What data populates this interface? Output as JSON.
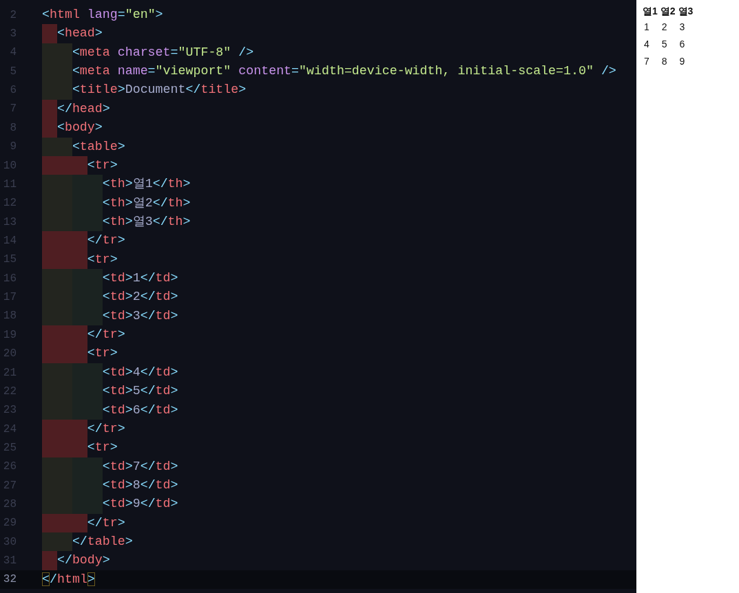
{
  "editor": {
    "lines": [
      {
        "number": "2",
        "current": false,
        "tokens": [
          {
            "kind": "bracket",
            "text": "<"
          },
          {
            "kind": "tag",
            "text": "html"
          },
          {
            "kind": "attr",
            "text": " lang"
          },
          {
            "kind": "punct",
            "text": "="
          },
          {
            "kind": "string",
            "text": "\"en\""
          },
          {
            "kind": "bracket",
            "text": ">"
          }
        ]
      },
      {
        "number": "3",
        "guides": [
          {
            "kind": "error-half"
          }
        ],
        "current": false,
        "tokens": [
          {
            "kind": "bracket",
            "text": "<"
          },
          {
            "kind": "tag",
            "text": "head"
          },
          {
            "kind": "bracket",
            "text": ">"
          }
        ]
      },
      {
        "number": "4",
        "guides": [
          {
            "kind": "ok"
          }
        ],
        "current": false,
        "tokens": [
          {
            "kind": "bracket",
            "text": "<"
          },
          {
            "kind": "tag",
            "text": "meta"
          },
          {
            "kind": "attr",
            "text": " charset"
          },
          {
            "kind": "punct",
            "text": "="
          },
          {
            "kind": "string",
            "text": "\"UTF-8\""
          },
          {
            "kind": "bracket",
            "text": " />"
          }
        ]
      },
      {
        "number": "5",
        "guides": [
          {
            "kind": "ok"
          }
        ],
        "current": false,
        "tokens": [
          {
            "kind": "bracket",
            "text": "<"
          },
          {
            "kind": "tag",
            "text": "meta"
          },
          {
            "kind": "attr",
            "text": " name"
          },
          {
            "kind": "punct",
            "text": "="
          },
          {
            "kind": "string",
            "text": "\"viewport\""
          },
          {
            "kind": "attr",
            "text": " content"
          },
          {
            "kind": "punct",
            "text": "="
          },
          {
            "kind": "string",
            "text": "\"width=device-width, initial-scale=1.0\""
          },
          {
            "kind": "bracket",
            "text": " />"
          }
        ]
      },
      {
        "number": "6",
        "guides": [
          {
            "kind": "ok"
          }
        ],
        "current": false,
        "tokens": [
          {
            "kind": "bracket",
            "text": "<"
          },
          {
            "kind": "tag",
            "text": "title"
          },
          {
            "kind": "bracket",
            "text": ">"
          },
          {
            "kind": "text",
            "text": "Document"
          },
          {
            "kind": "bracket",
            "text": "</"
          },
          {
            "kind": "tag",
            "text": "title"
          },
          {
            "kind": "bracket",
            "text": ">"
          }
        ]
      },
      {
        "number": "7",
        "guides": [
          {
            "kind": "error-half"
          }
        ],
        "current": false,
        "tokens": [
          {
            "kind": "bracket",
            "text": "</"
          },
          {
            "kind": "tag",
            "text": "head"
          },
          {
            "kind": "bracket",
            "text": ">"
          }
        ]
      },
      {
        "number": "8",
        "guides": [
          {
            "kind": "error-half"
          }
        ],
        "current": false,
        "tokens": [
          {
            "kind": "bracket",
            "text": "<"
          },
          {
            "kind": "tag",
            "text": "body"
          },
          {
            "kind": "bracket",
            "text": ">"
          }
        ]
      },
      {
        "number": "9",
        "guides": [
          {
            "kind": "ok"
          }
        ],
        "current": false,
        "tokens": [
          {
            "kind": "bracket",
            "text": "<"
          },
          {
            "kind": "tag",
            "text": "table"
          },
          {
            "kind": "bracket",
            "text": ">"
          }
        ]
      },
      {
        "number": "10",
        "guides": [
          {
            "kind": "error"
          },
          {
            "kind": "error-half"
          }
        ],
        "current": false,
        "tokens": [
          {
            "kind": "bracket",
            "text": "<"
          },
          {
            "kind": "tag",
            "text": "tr"
          },
          {
            "kind": "bracket",
            "text": ">"
          }
        ]
      },
      {
        "number": "11",
        "guides": [
          {
            "kind": "ok"
          },
          {
            "kind": "ok"
          }
        ],
        "current": false,
        "tokens": [
          {
            "kind": "bracket",
            "text": "<"
          },
          {
            "kind": "tag",
            "text": "th"
          },
          {
            "kind": "bracket",
            "text": ">"
          },
          {
            "kind": "text",
            "text": "열1"
          },
          {
            "kind": "bracket",
            "text": "</"
          },
          {
            "kind": "tag",
            "text": "th"
          },
          {
            "kind": "bracket",
            "text": ">"
          }
        ]
      },
      {
        "number": "12",
        "guides": [
          {
            "kind": "ok"
          },
          {
            "kind": "ok"
          }
        ],
        "current": false,
        "tokens": [
          {
            "kind": "bracket",
            "text": "<"
          },
          {
            "kind": "tag",
            "text": "th"
          },
          {
            "kind": "bracket",
            "text": ">"
          },
          {
            "kind": "text",
            "text": "열2"
          },
          {
            "kind": "bracket",
            "text": "</"
          },
          {
            "kind": "tag",
            "text": "th"
          },
          {
            "kind": "bracket",
            "text": ">"
          }
        ]
      },
      {
        "number": "13",
        "guides": [
          {
            "kind": "ok"
          },
          {
            "kind": "ok"
          }
        ],
        "current": false,
        "tokens": [
          {
            "kind": "bracket",
            "text": "<"
          },
          {
            "kind": "tag",
            "text": "th"
          },
          {
            "kind": "bracket",
            "text": ">"
          },
          {
            "kind": "text",
            "text": "열3"
          },
          {
            "kind": "bracket",
            "text": "</"
          },
          {
            "kind": "tag",
            "text": "th"
          },
          {
            "kind": "bracket",
            "text": ">"
          }
        ]
      },
      {
        "number": "14",
        "guides": [
          {
            "kind": "error"
          },
          {
            "kind": "error-half"
          }
        ],
        "current": false,
        "tokens": [
          {
            "kind": "bracket",
            "text": "</"
          },
          {
            "kind": "tag",
            "text": "tr"
          },
          {
            "kind": "bracket",
            "text": ">"
          }
        ]
      },
      {
        "number": "15",
        "guides": [
          {
            "kind": "error"
          },
          {
            "kind": "error-half"
          }
        ],
        "current": false,
        "tokens": [
          {
            "kind": "bracket",
            "text": "<"
          },
          {
            "kind": "tag",
            "text": "tr"
          },
          {
            "kind": "bracket",
            "text": ">"
          }
        ]
      },
      {
        "number": "16",
        "guides": [
          {
            "kind": "ok"
          },
          {
            "kind": "ok"
          }
        ],
        "current": false,
        "tokens": [
          {
            "kind": "bracket",
            "text": "<"
          },
          {
            "kind": "tag",
            "text": "td"
          },
          {
            "kind": "bracket",
            "text": ">"
          },
          {
            "kind": "text",
            "text": "1"
          },
          {
            "kind": "bracket",
            "text": "</"
          },
          {
            "kind": "tag",
            "text": "td"
          },
          {
            "kind": "bracket",
            "text": ">"
          }
        ]
      },
      {
        "number": "17",
        "guides": [
          {
            "kind": "ok"
          },
          {
            "kind": "ok"
          }
        ],
        "current": false,
        "tokens": [
          {
            "kind": "bracket",
            "text": "<"
          },
          {
            "kind": "tag",
            "text": "td"
          },
          {
            "kind": "bracket",
            "text": ">"
          },
          {
            "kind": "text",
            "text": "2"
          },
          {
            "kind": "bracket",
            "text": "</"
          },
          {
            "kind": "tag",
            "text": "td"
          },
          {
            "kind": "bracket",
            "text": ">"
          }
        ]
      },
      {
        "number": "18",
        "guides": [
          {
            "kind": "ok"
          },
          {
            "kind": "ok"
          }
        ],
        "current": false,
        "tokens": [
          {
            "kind": "bracket",
            "text": "<"
          },
          {
            "kind": "tag",
            "text": "td"
          },
          {
            "kind": "bracket",
            "text": ">"
          },
          {
            "kind": "text",
            "text": "3"
          },
          {
            "kind": "bracket",
            "text": "</"
          },
          {
            "kind": "tag",
            "text": "td"
          },
          {
            "kind": "bracket",
            "text": ">"
          }
        ]
      },
      {
        "number": "19",
        "guides": [
          {
            "kind": "error"
          },
          {
            "kind": "error-half"
          }
        ],
        "current": false,
        "tokens": [
          {
            "kind": "bracket",
            "text": "</"
          },
          {
            "kind": "tag",
            "text": "tr"
          },
          {
            "kind": "bracket",
            "text": ">"
          }
        ]
      },
      {
        "number": "20",
        "guides": [
          {
            "kind": "error"
          },
          {
            "kind": "error-half"
          }
        ],
        "current": false,
        "tokens": [
          {
            "kind": "bracket",
            "text": "<"
          },
          {
            "kind": "tag",
            "text": "tr"
          },
          {
            "kind": "bracket",
            "text": ">"
          }
        ]
      },
      {
        "number": "21",
        "guides": [
          {
            "kind": "ok"
          },
          {
            "kind": "ok"
          }
        ],
        "current": false,
        "tokens": [
          {
            "kind": "bracket",
            "text": "<"
          },
          {
            "kind": "tag",
            "text": "td"
          },
          {
            "kind": "bracket",
            "text": ">"
          },
          {
            "kind": "text",
            "text": "4"
          },
          {
            "kind": "bracket",
            "text": "</"
          },
          {
            "kind": "tag",
            "text": "td"
          },
          {
            "kind": "bracket",
            "text": ">"
          }
        ]
      },
      {
        "number": "22",
        "guides": [
          {
            "kind": "ok"
          },
          {
            "kind": "ok"
          }
        ],
        "current": false,
        "tokens": [
          {
            "kind": "bracket",
            "text": "<"
          },
          {
            "kind": "tag",
            "text": "td"
          },
          {
            "kind": "bracket",
            "text": ">"
          },
          {
            "kind": "text",
            "text": "5"
          },
          {
            "kind": "bracket",
            "text": "</"
          },
          {
            "kind": "tag",
            "text": "td"
          },
          {
            "kind": "bracket",
            "text": ">"
          }
        ]
      },
      {
        "number": "23",
        "guides": [
          {
            "kind": "ok"
          },
          {
            "kind": "ok"
          }
        ],
        "current": false,
        "tokens": [
          {
            "kind": "bracket",
            "text": "<"
          },
          {
            "kind": "tag",
            "text": "td"
          },
          {
            "kind": "bracket",
            "text": ">"
          },
          {
            "kind": "text",
            "text": "6"
          },
          {
            "kind": "bracket",
            "text": "</"
          },
          {
            "kind": "tag",
            "text": "td"
          },
          {
            "kind": "bracket",
            "text": ">"
          }
        ]
      },
      {
        "number": "24",
        "guides": [
          {
            "kind": "error"
          },
          {
            "kind": "error-half"
          }
        ],
        "current": false,
        "tokens": [
          {
            "kind": "bracket",
            "text": "</"
          },
          {
            "kind": "tag",
            "text": "tr"
          },
          {
            "kind": "bracket",
            "text": ">"
          }
        ]
      },
      {
        "number": "25",
        "guides": [
          {
            "kind": "error"
          },
          {
            "kind": "error-half"
          }
        ],
        "current": false,
        "tokens": [
          {
            "kind": "bracket",
            "text": "<"
          },
          {
            "kind": "tag",
            "text": "tr"
          },
          {
            "kind": "bracket",
            "text": ">"
          }
        ]
      },
      {
        "number": "26",
        "guides": [
          {
            "kind": "ok"
          },
          {
            "kind": "ok"
          }
        ],
        "current": false,
        "tokens": [
          {
            "kind": "bracket",
            "text": "<"
          },
          {
            "kind": "tag",
            "text": "td"
          },
          {
            "kind": "bracket",
            "text": ">"
          },
          {
            "kind": "text",
            "text": "7"
          },
          {
            "kind": "bracket",
            "text": "</"
          },
          {
            "kind": "tag",
            "text": "td"
          },
          {
            "kind": "bracket",
            "text": ">"
          }
        ]
      },
      {
        "number": "27",
        "guides": [
          {
            "kind": "ok"
          },
          {
            "kind": "ok"
          }
        ],
        "current": false,
        "tokens": [
          {
            "kind": "bracket",
            "text": "<"
          },
          {
            "kind": "tag",
            "text": "td"
          },
          {
            "kind": "bracket",
            "text": ">"
          },
          {
            "kind": "text",
            "text": "8"
          },
          {
            "kind": "bracket",
            "text": "</"
          },
          {
            "kind": "tag",
            "text": "td"
          },
          {
            "kind": "bracket",
            "text": ">"
          }
        ]
      },
      {
        "number": "28",
        "guides": [
          {
            "kind": "ok"
          },
          {
            "kind": "ok"
          }
        ],
        "current": false,
        "tokens": [
          {
            "kind": "bracket",
            "text": "<"
          },
          {
            "kind": "tag",
            "text": "td"
          },
          {
            "kind": "bracket",
            "text": ">"
          },
          {
            "kind": "text",
            "text": "9"
          },
          {
            "kind": "bracket",
            "text": "</"
          },
          {
            "kind": "tag",
            "text": "td"
          },
          {
            "kind": "bracket",
            "text": ">"
          }
        ]
      },
      {
        "number": "29",
        "guides": [
          {
            "kind": "error"
          },
          {
            "kind": "error-half"
          }
        ],
        "current": false,
        "tokens": [
          {
            "kind": "bracket",
            "text": "</"
          },
          {
            "kind": "tag",
            "text": "tr"
          },
          {
            "kind": "bracket",
            "text": ">"
          }
        ]
      },
      {
        "number": "30",
        "guides": [
          {
            "kind": "ok"
          }
        ],
        "current": false,
        "tokens": [
          {
            "kind": "bracket",
            "text": "</"
          },
          {
            "kind": "tag",
            "text": "table"
          },
          {
            "kind": "bracket",
            "text": ">"
          }
        ]
      },
      {
        "number": "31",
        "guides": [
          {
            "kind": "error-half"
          }
        ],
        "current": false,
        "tokens": [
          {
            "kind": "bracket",
            "text": "</"
          },
          {
            "kind": "tag",
            "text": "body"
          },
          {
            "kind": "bracket",
            "text": ">"
          }
        ]
      },
      {
        "number": "32",
        "current": true,
        "tokens": [
          {
            "kind": "matched",
            "text": "<"
          },
          {
            "kind": "bracket",
            "text": "/"
          },
          {
            "kind": "tag",
            "text": "html"
          },
          {
            "kind": "matched",
            "text": ">"
          }
        ]
      }
    ]
  },
  "preview": {
    "columns": [
      "열1",
      "열2",
      "열3"
    ],
    "rows": [
      [
        "1",
        "2",
        "3"
      ],
      [
        "4",
        "5",
        "6"
      ],
      [
        "7",
        "8",
        "9"
      ]
    ]
  }
}
